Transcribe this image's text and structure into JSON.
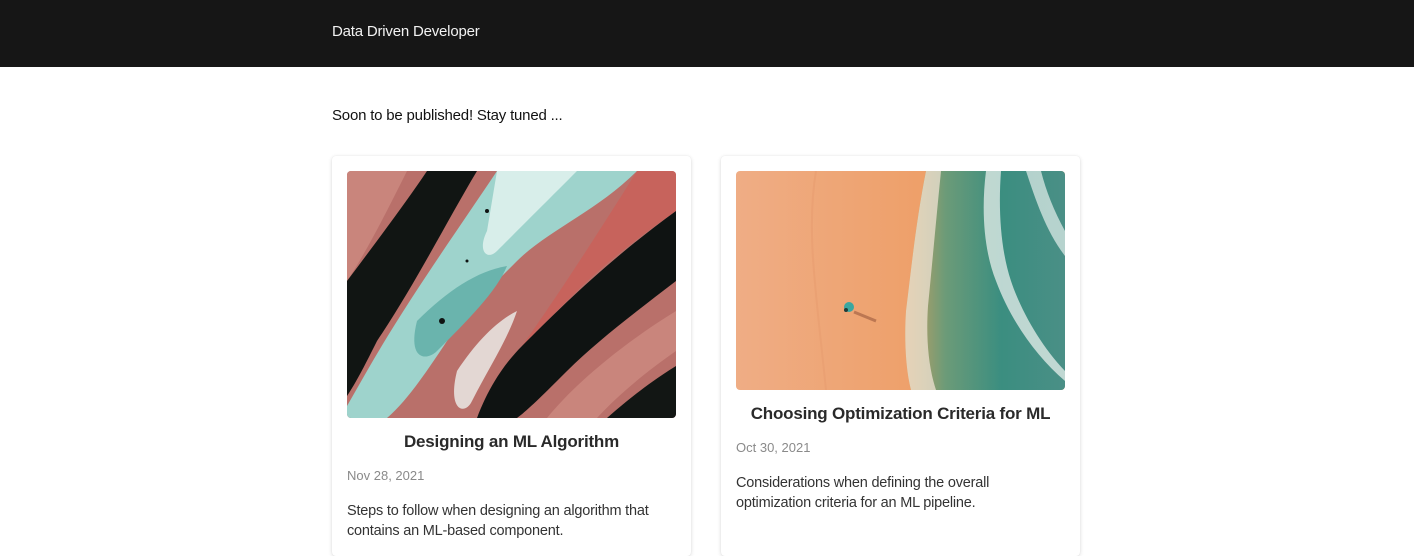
{
  "header": {
    "site_title": "Data Driven Developer"
  },
  "main": {
    "intro": "Soon to be published! Stay tuned ..."
  },
  "posts": [
    {
      "title": "Designing an ML Algorithm",
      "date": "Nov 28, 2021",
      "summary": "Steps to follow when designing an algorithm that contains an ML-based component.",
      "image_icon": "abstract-paint-image"
    },
    {
      "title": "Choosing Optimization Criteria for ML",
      "date": "Oct 30, 2021",
      "summary": "Considerations when defining the overall optimization criteria for an ML pipeline.",
      "image_icon": "beach-aerial-image"
    }
  ],
  "colors": {
    "header_bg": "#161616",
    "header_text": "#f2f2f2",
    "date_text": "#8a8a8a"
  }
}
